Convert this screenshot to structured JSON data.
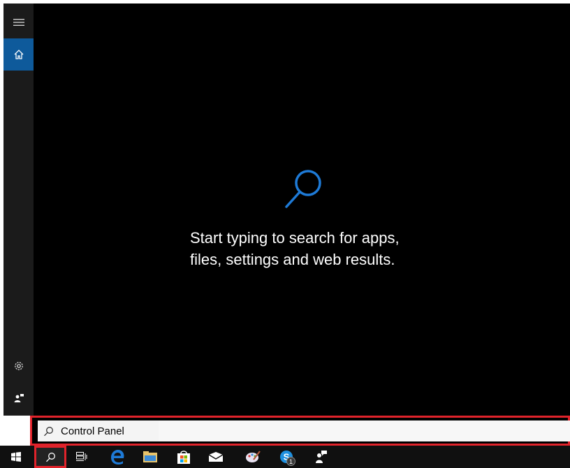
{
  "flyout": {
    "hint_line1": "Start typing to search for apps,",
    "hint_line2": "files, settings and web results."
  },
  "rail": {
    "items": [
      {
        "icon": "hamburger-menu-icon"
      },
      {
        "icon": "home-icon",
        "active": true
      },
      {
        "icon": "gear-icon"
      },
      {
        "icon": "feedback-icon"
      }
    ]
  },
  "search": {
    "value": "Control Panel",
    "icon": "search-icon"
  },
  "taskbar": {
    "items": [
      {
        "icon": "windows-start-icon"
      },
      {
        "icon": "search-icon",
        "highlighted": true
      },
      {
        "icon": "task-view-icon"
      },
      {
        "icon": "edge-browser-icon"
      },
      {
        "icon": "file-explorer-icon"
      },
      {
        "icon": "store-icon"
      },
      {
        "icon": "mail-icon"
      },
      {
        "icon": "paint-icon"
      },
      {
        "icon": "skype-icon",
        "badge": "1"
      },
      {
        "icon": "feedback-hub-icon"
      }
    ]
  },
  "colors": {
    "accent": "#0e5a9b",
    "search_glass": "#1e7ad6",
    "highlight_border": "#e0232b",
    "flyout_bg": "#000000",
    "rail_bg": "#1b1b1b",
    "taskbar_bg": "#101010"
  }
}
